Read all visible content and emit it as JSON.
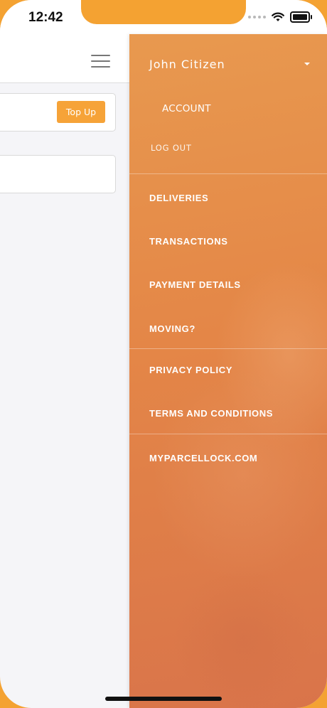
{
  "status_bar": {
    "time": "12:42"
  },
  "main": {
    "topup_label": "Top Up"
  },
  "drawer": {
    "user_name": "John Citizen",
    "account_label": "ACCOUNT",
    "logout_label": "LOG OUT",
    "items": [
      {
        "label": "DELIVERIES"
      },
      {
        "label": "TRANSACTIONS"
      },
      {
        "label": "PAYMENT DETAILS"
      },
      {
        "label": "MOVING?"
      },
      {
        "label": "PRIVACY POLICY"
      },
      {
        "label": "TERMS AND CONDITIONS"
      },
      {
        "label": "MYPARCELLOCK.COM"
      }
    ]
  },
  "colors": {
    "accent": "#f4a232",
    "drawer": "#e48647"
  },
  "icons": [
    "signal-icon",
    "wifi-icon",
    "battery-icon",
    "hamburger-menu-icon",
    "caret-down-icon"
  ]
}
